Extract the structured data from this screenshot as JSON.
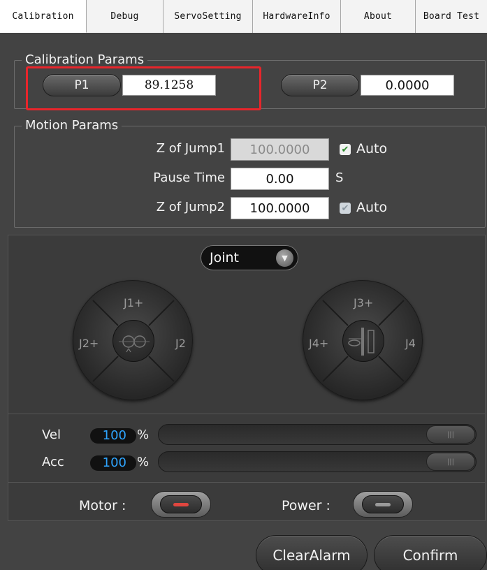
{
  "tabs": [
    {
      "label": "Calibration",
      "active": true
    },
    {
      "label": "Debug",
      "active": false
    },
    {
      "label": "ServoSetting",
      "active": false
    },
    {
      "label": "HardwareInfo",
      "active": false
    },
    {
      "label": "About",
      "active": false
    },
    {
      "label": "Board Test",
      "active": false
    }
  ],
  "calibration": {
    "title": "Calibration Params",
    "p1_label": "P1",
    "p1_value": "89.1258",
    "p2_label": "P2",
    "p2_value": "0.0000"
  },
  "motion": {
    "title": "Motion Params",
    "jump1_label": "Z of Jump1",
    "jump1_value": "100.0000",
    "jump1_auto_label": "Auto",
    "jump1_auto_checked": true,
    "pause_label": "Pause Time",
    "pause_value": "0.00",
    "pause_unit": "S",
    "jump2_label": "Z of Jump2",
    "jump2_value": "100.0000",
    "jump2_auto_label": "Auto",
    "jump2_auto_checked": true
  },
  "jog": {
    "mode": "Joint",
    "left_dial": {
      "top": "J1+",
      "left": "J2+",
      "right": "J2"
    },
    "right_dial": {
      "top": "J3+",
      "left": "J4+",
      "right": "J4"
    }
  },
  "speed": {
    "vel_label": "Vel",
    "vel_value": "100",
    "vel_unit": "%",
    "vel_fraction": 1.0,
    "acc_label": "Acc",
    "acc_value": "100",
    "acc_unit": "%",
    "acc_fraction": 1.0
  },
  "switches": {
    "motor_label": "Motor :",
    "motor_indicator_color": "#e0463f",
    "power_label": "Power :",
    "power_indicator_color": "#9a9a9a"
  },
  "actions": {
    "clear_alarm": "ClearAlarm",
    "confirm": "Confirm"
  },
  "colors": {
    "accent_value": "#2fa5ff",
    "highlight": "#e8252b",
    "check": "#2c8b2c"
  }
}
